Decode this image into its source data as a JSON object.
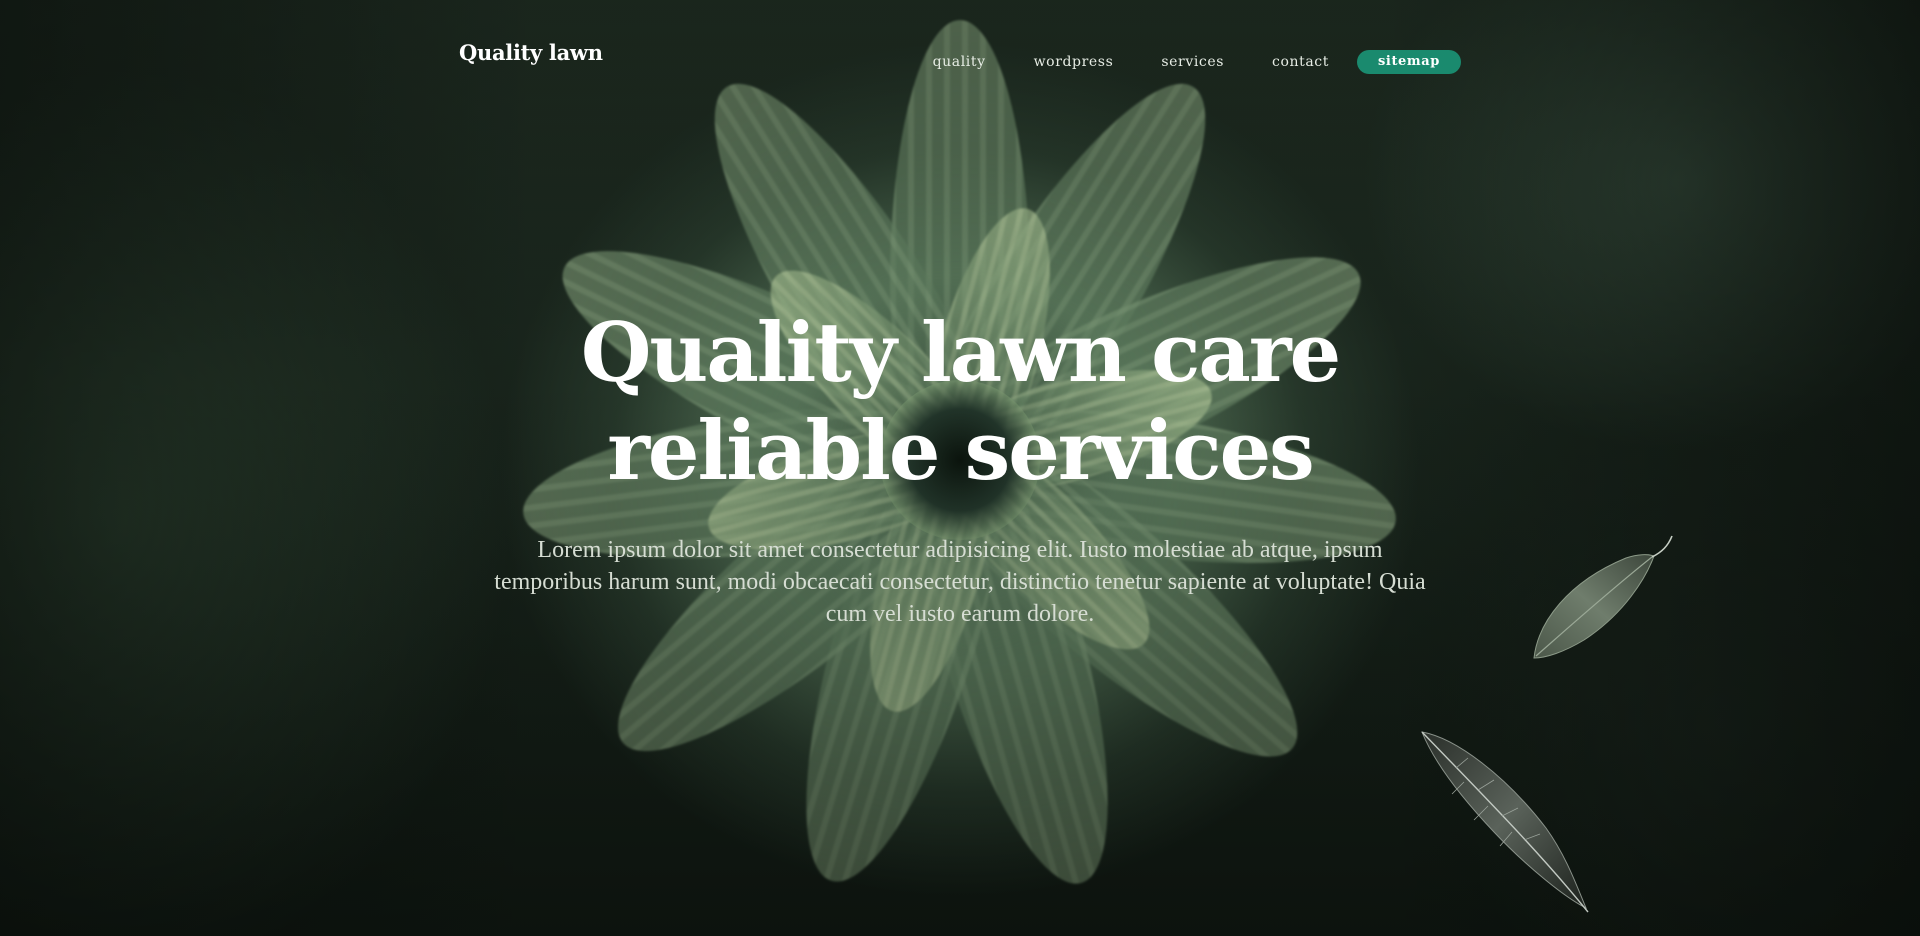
{
  "nav": {
    "brand": "Quality lawn",
    "links": [
      {
        "label": "quality"
      },
      {
        "label": "wordpress"
      },
      {
        "label": "services"
      },
      {
        "label": "contact"
      }
    ],
    "cta_label": "sitemap"
  },
  "hero": {
    "headline_line1": "Quality lawn care",
    "headline_line2": "reliable services",
    "description": "Lorem ipsum dolor sit amet consectetur adipisicing elit. Iusto molestiae ab atque, ipsum temporibus harum sunt, modi obcaecati consectetur, distinctio tenetur sapiente at voluptate! Quia cum vel iusto earum dolore."
  },
  "colors": {
    "accent": "#1a8a6e",
    "text": "#ffffff",
    "muted_text": "#d6ddd3",
    "background": "#1d2a20"
  },
  "icons": {
    "decoration_top": "olive-leaf-icon",
    "decoration_bottom": "dark-leaf-icon"
  }
}
